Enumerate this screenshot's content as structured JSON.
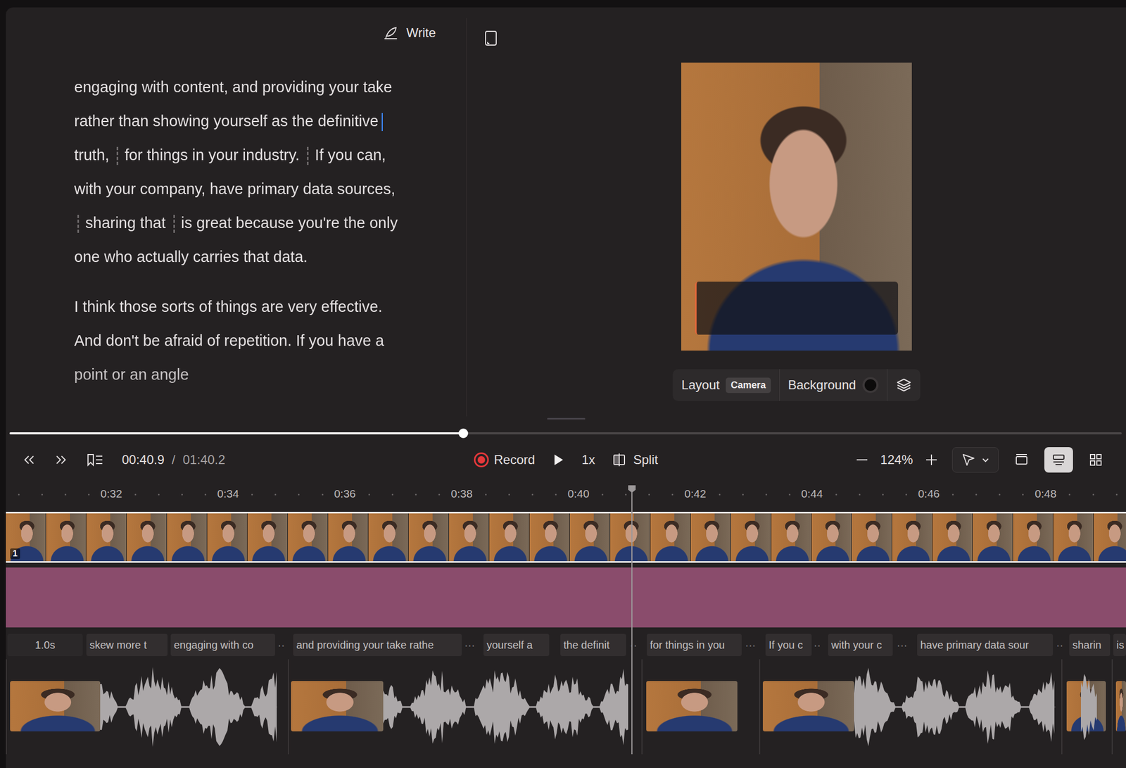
{
  "editor": {
    "write_label": "Write"
  },
  "script": {
    "paragraphs": [
      {
        "segments": [
          {
            "kind": "text",
            "text": "engaging with content, and providing your take rather than showing yourself as the definitive "
          },
          {
            "kind": "cursor"
          },
          {
            "kind": "text",
            "text": "truth, "
          },
          {
            "kind": "split"
          },
          {
            "kind": "text",
            "text": "for things in your industry. "
          },
          {
            "kind": "split"
          },
          {
            "kind": "text",
            "text": "If you can, with your company, have primary data sources, "
          },
          {
            "kind": "split"
          },
          {
            "kind": "text",
            "text": "sharing that "
          },
          {
            "kind": "split"
          },
          {
            "kind": "text",
            "text": "is great because you're the only one who actually carries that data."
          }
        ]
      },
      {
        "segments": [
          {
            "kind": "text",
            "text": "I think those sorts of things are very effective. And don't be afraid of repetition. If you have a point or an angle"
          }
        ]
      }
    ]
  },
  "preview": {
    "layout_label": "Layout",
    "layout_value": "Camera",
    "background_label": "Background"
  },
  "playback": {
    "level": 0.408,
    "current": "00:40.9",
    "separator": "/",
    "total": "01:40.2",
    "record_label": "Record",
    "speed": "1x",
    "split_label": "Split",
    "zoom": "124%"
  },
  "view_modes": [
    {
      "selected": false
    },
    {
      "selected": true
    },
    {
      "selected": false
    }
  ],
  "timeline": {
    "ruler": [
      "0:32",
      "0:34",
      "0:36",
      "0:38",
      "0:40",
      "0:42",
      "0:44",
      "0:46",
      "0:48"
    ],
    "clip_badge": "1",
    "captions": [
      {
        "text": "1.0s",
        "kind": "pause"
      },
      {
        "text": "skew more t",
        "kind": "word"
      },
      {
        "text": "engaging with co",
        "kind": "word"
      },
      {
        "text": "··",
        "kind": "break"
      },
      {
        "text": "and providing your take rathe",
        "kind": "word"
      },
      {
        "text": "···",
        "kind": "break"
      },
      {
        "text": "yourself a",
        "kind": "word"
      },
      {
        "text": "the definit",
        "kind": "word"
      },
      {
        "text": "··",
        "kind": "break"
      },
      {
        "text": "for things in you",
        "kind": "word"
      },
      {
        "text": "···",
        "kind": "break"
      },
      {
        "text": "If you c",
        "kind": "word"
      },
      {
        "text": "··",
        "kind": "break"
      },
      {
        "text": "with your c",
        "kind": "word"
      },
      {
        "text": "···",
        "kind": "break"
      },
      {
        "text": "have primary data sour",
        "kind": "word"
      },
      {
        "text": "··",
        "kind": "break"
      },
      {
        "text": "sharin",
        "kind": "word"
      },
      {
        "text": "is",
        "kind": "word"
      }
    ]
  }
}
